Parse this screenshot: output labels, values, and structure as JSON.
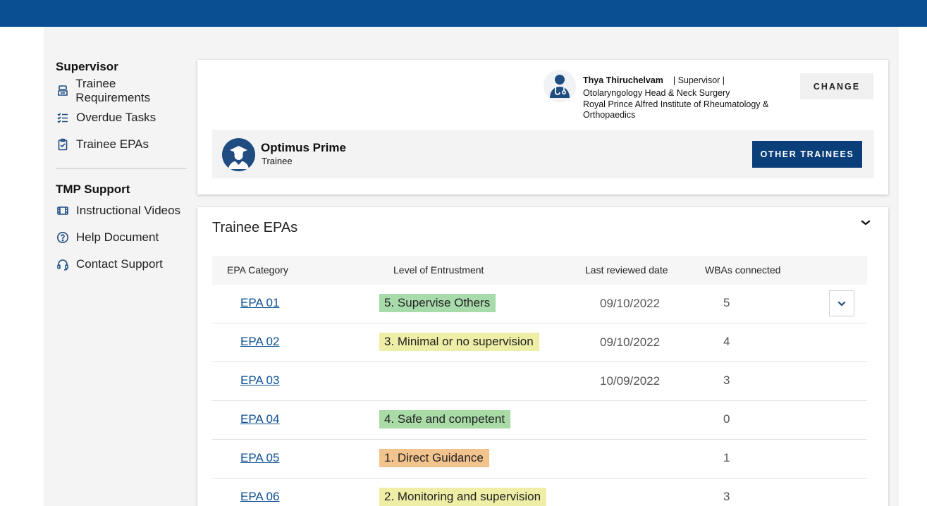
{
  "colors": {
    "brand_blue": "#0b4f93",
    "dark_button": "#0b3f7a",
    "level_green": "#a8dbab",
    "level_yellow": "#eeeea6",
    "level_orange": "#f3c38d",
    "level_pale_green": "#a9dba7"
  },
  "sidebar": {
    "supervisor_heading": "Supervisor",
    "supervisor_items": [
      {
        "label": "Trainee Requirements",
        "icon": "requirements-icon"
      },
      {
        "label": "Overdue Tasks",
        "icon": "task-list-icon"
      },
      {
        "label": "Trainee EPAs",
        "icon": "clipboard-check-icon"
      }
    ],
    "support_heading": "TMP Support",
    "support_items": [
      {
        "label": "Instructional Videos",
        "icon": "film-icon"
      },
      {
        "label": "Help Document",
        "icon": "help-circle-icon"
      },
      {
        "label": "Contact Support",
        "icon": "headset-icon"
      }
    ]
  },
  "supervisor": {
    "name": "Thya Thiruchelvam",
    "role": "| Supervisor |",
    "specialty": "Otolaryngology Head & Neck Surgery",
    "institution_line1": "Royal Prince Alfred Institute of Rheumatology &",
    "institution_line2": "Orthopaedics",
    "change_label": "CHANGE"
  },
  "trainee": {
    "name": "Optimus Prime",
    "role": "Trainee",
    "other_trainees_label": "OTHER TRAINEES"
  },
  "epa_section": {
    "title": "Trainee EPAs",
    "columns": [
      "EPA Category",
      "Level of Entrustment",
      "Last reviewed date",
      "WBAs connected"
    ],
    "rows": [
      {
        "epa": "EPA 01",
        "level": "5. Supervise Others",
        "level_color": "#a8dbab",
        "date": "09/10/2022",
        "wbas": "5"
      },
      {
        "epa": "EPA 02",
        "level": "3. Minimal or no supervision",
        "level_color": "#eeeea6",
        "date": "09/10/2022",
        "wbas": "4"
      },
      {
        "epa": "EPA 03",
        "level": "",
        "level_color": "",
        "date": "10/09/2022",
        "wbas": "3"
      },
      {
        "epa": "EPA 04",
        "level": "4. Safe and competent",
        "level_color": "#a9dba7",
        "date": "",
        "wbas": "0"
      },
      {
        "epa": "EPA 05",
        "level": "1. Direct Guidance",
        "level_color": "#f3c38d",
        "date": "",
        "wbas": "1"
      },
      {
        "epa": "EPA 06",
        "level": "2. Monitoring and supervision",
        "level_color": "#eeeea6",
        "date": "",
        "wbas": "3"
      }
    ]
  }
}
